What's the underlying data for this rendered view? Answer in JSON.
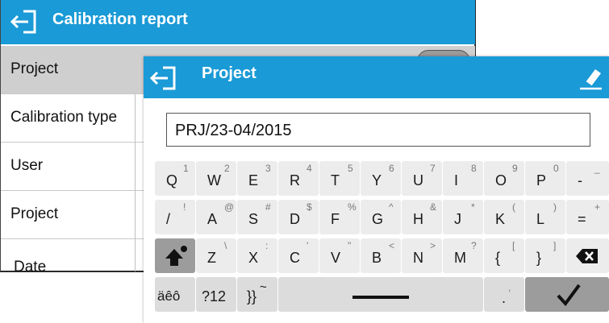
{
  "background": {
    "title": "Calibration report",
    "rows": [
      {
        "label": "Project",
        "selected": true
      },
      {
        "label": "Calibration type",
        "selected": false
      },
      {
        "label": "User",
        "selected": false
      },
      {
        "label": "Project",
        "selected": false
      },
      {
        "label": "Date",
        "selected": false
      }
    ]
  },
  "dialog": {
    "title": "Project",
    "input_value": "PRJ/23-04/2015"
  },
  "keyboard": {
    "row1": [
      {
        "m": "Q",
        "s": "1"
      },
      {
        "m": "W",
        "s": "2"
      },
      {
        "m": "E",
        "s": "3"
      },
      {
        "m": "R",
        "s": "4"
      },
      {
        "m": "T",
        "s": "5"
      },
      {
        "m": "Y",
        "s": "6"
      },
      {
        "m": "U",
        "s": "7"
      },
      {
        "m": "I",
        "s": "8"
      },
      {
        "m": "O",
        "s": "9"
      },
      {
        "m": "P",
        "s": "0"
      },
      {
        "m": "-",
        "s": "_"
      }
    ],
    "row2": [
      {
        "m": "/",
        "s": "!"
      },
      {
        "m": "A",
        "s": "@"
      },
      {
        "m": "S",
        "s": "#"
      },
      {
        "m": "D",
        "s": "$"
      },
      {
        "m": "F",
        "s": "%"
      },
      {
        "m": "G",
        "s": "^"
      },
      {
        "m": "H",
        "s": "&"
      },
      {
        "m": "J",
        "s": "*"
      },
      {
        "m": "K",
        "s": "("
      },
      {
        "m": "L",
        "s": ")"
      },
      {
        "m": "=",
        "s": "+"
      }
    ],
    "row3": [
      {
        "m": "Z",
        "s": "\\"
      },
      {
        "m": "X",
        "s": ":"
      },
      {
        "m": "C",
        "s": "'"
      },
      {
        "m": "V",
        "s": "\""
      },
      {
        "m": "B",
        "s": "<"
      },
      {
        "m": "N",
        "s": ">"
      },
      {
        "m": "M",
        "s": "?"
      },
      {
        "m": "{",
        "s": "["
      },
      {
        "m": "}",
        "s": "]"
      }
    ],
    "row4": {
      "accents": "äêô",
      "numbers": "?12",
      "symbols": "}}",
      "symbols_sup": "~",
      "dot": ".",
      "dot_sup": ","
    }
  }
}
